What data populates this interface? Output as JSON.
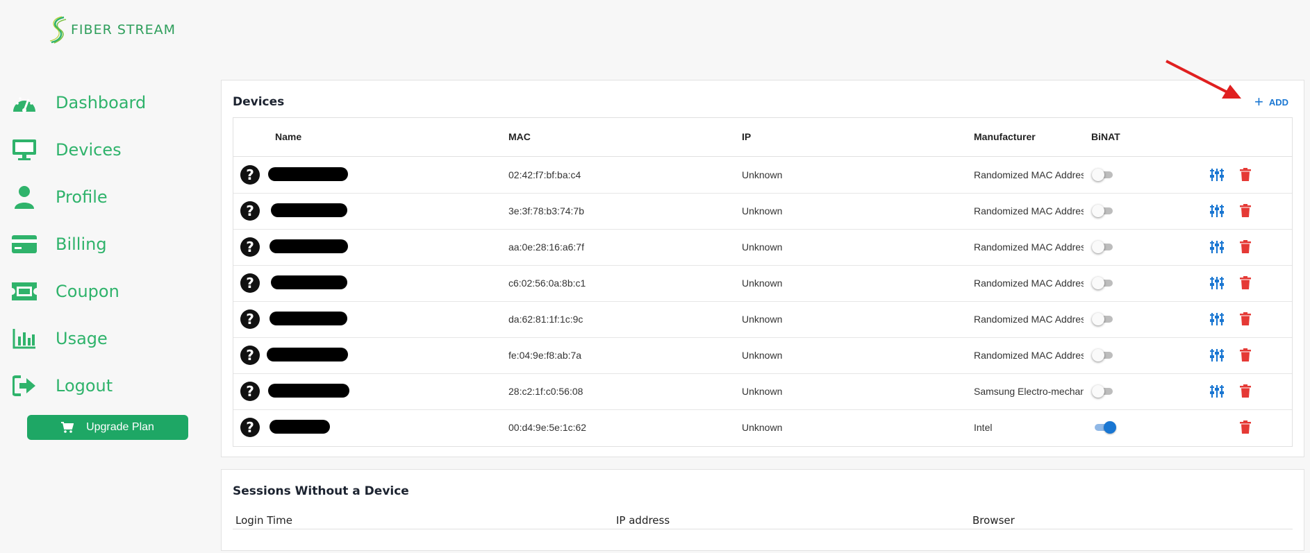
{
  "brand": {
    "name": "FIBER STREAM"
  },
  "sidebar": {
    "items": [
      {
        "label": "Dashboard",
        "icon": "speedometer-icon"
      },
      {
        "label": "Devices",
        "icon": "monitor-icon"
      },
      {
        "label": "Profile",
        "icon": "person-icon"
      },
      {
        "label": "Billing",
        "icon": "credit-card-icon"
      },
      {
        "label": "Coupon",
        "icon": "ticket-icon"
      },
      {
        "label": "Usage",
        "icon": "bar-chart-icon"
      },
      {
        "label": "Logout",
        "icon": "logout-icon"
      }
    ],
    "upgrade_label": "Upgrade Plan"
  },
  "devices": {
    "title": "Devices",
    "add_label": "ADD",
    "columns": {
      "name": "Name",
      "mac": "MAC",
      "ip": "IP",
      "manufacturer": "Manufacturer",
      "binat": "BiNAT"
    },
    "rows": [
      {
        "mac": "02:42:f7:bf:ba:c4",
        "ip": "Unknown",
        "manufacturer": "Randomized MAC Address",
        "binat": false,
        "tunable": true
      },
      {
        "mac": "3e:3f:78:b3:74:7b",
        "ip": "Unknown",
        "manufacturer": "Randomized MAC Address",
        "binat": false,
        "tunable": true
      },
      {
        "mac": "aa:0e:28:16:a6:7f",
        "ip": "Unknown",
        "manufacturer": "Randomized MAC Address",
        "binat": false,
        "tunable": true
      },
      {
        "mac": "c6:02:56:0a:8b:c1",
        "ip": "Unknown",
        "manufacturer": "Randomized MAC Address",
        "binat": false,
        "tunable": true
      },
      {
        "mac": "da:62:81:1f:1c:9c",
        "ip": "Unknown",
        "manufacturer": "Randomized MAC Address",
        "binat": false,
        "tunable": true
      },
      {
        "mac": "fe:04:9e:f8:ab:7a",
        "ip": "Unknown",
        "manufacturer": "Randomized MAC Address",
        "binat": false,
        "tunable": true
      },
      {
        "mac": "28:c2:1f:c0:56:08",
        "ip": "Unknown",
        "manufacturer": "Samsung Electro-mechanics",
        "binat": false,
        "tunable": true
      },
      {
        "mac": "00:d4:9e:5e:1c:62",
        "ip": "Unknown",
        "manufacturer": "Intel",
        "binat": true,
        "tunable": false
      }
    ]
  },
  "sessions": {
    "title": "Sessions Without a Device",
    "columns": {
      "login_time": "Login Time",
      "ip_address": "IP address",
      "browser": "Browser"
    }
  },
  "colors": {
    "brand_green": "#2fb36b",
    "button_green": "#1ea765",
    "action_blue": "#1976d2",
    "delete_red": "#e53935"
  }
}
